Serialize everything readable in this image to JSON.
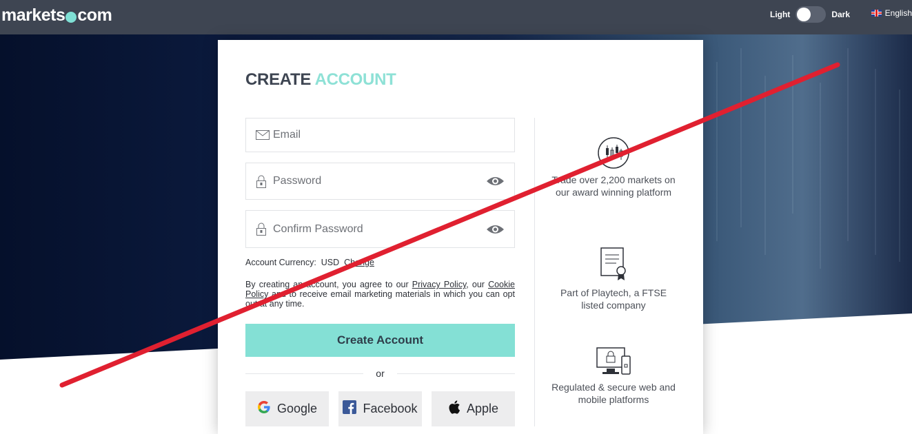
{
  "header": {
    "logo_left": "markets",
    "logo_right": "com",
    "theme_light_label": "Light",
    "theme_dark_label": "Dark",
    "language_label": "English"
  },
  "form": {
    "title_main": "CREATE",
    "title_accent": "ACCOUNT",
    "email_placeholder": "Email",
    "password_placeholder": "Password",
    "confirm_password_placeholder": "Confirm Password",
    "currency_label": "Account Currency:",
    "currency_value": "USD",
    "currency_change": "Change",
    "terms_prefix": "By creating an account, you agree to our ",
    "privacy_policy": "Privacy Policy",
    "terms_mid": ", our ",
    "cookie_policy": "Cookie Policy",
    "terms_suffix": " and to receive email marketing materials in which you can opt out at any time.",
    "create_button": "Create Account",
    "or_label": "or",
    "google_label": "Google",
    "facebook_label": "Facebook",
    "apple_label": "Apple"
  },
  "features": [
    {
      "icon": "candlestick-chart-icon",
      "text": "Trade over 2,200 markets on our award winning platform"
    },
    {
      "icon": "certificate-icon",
      "text": "Part of Playtech, a FTSE listed company"
    },
    {
      "icon": "secure-devices-icon",
      "text": "Regulated & secure web and mobile platforms"
    }
  ],
  "colors": {
    "header_bg": "#3e4552",
    "accent": "#84e0d5",
    "annotation_line": "#e02030"
  }
}
